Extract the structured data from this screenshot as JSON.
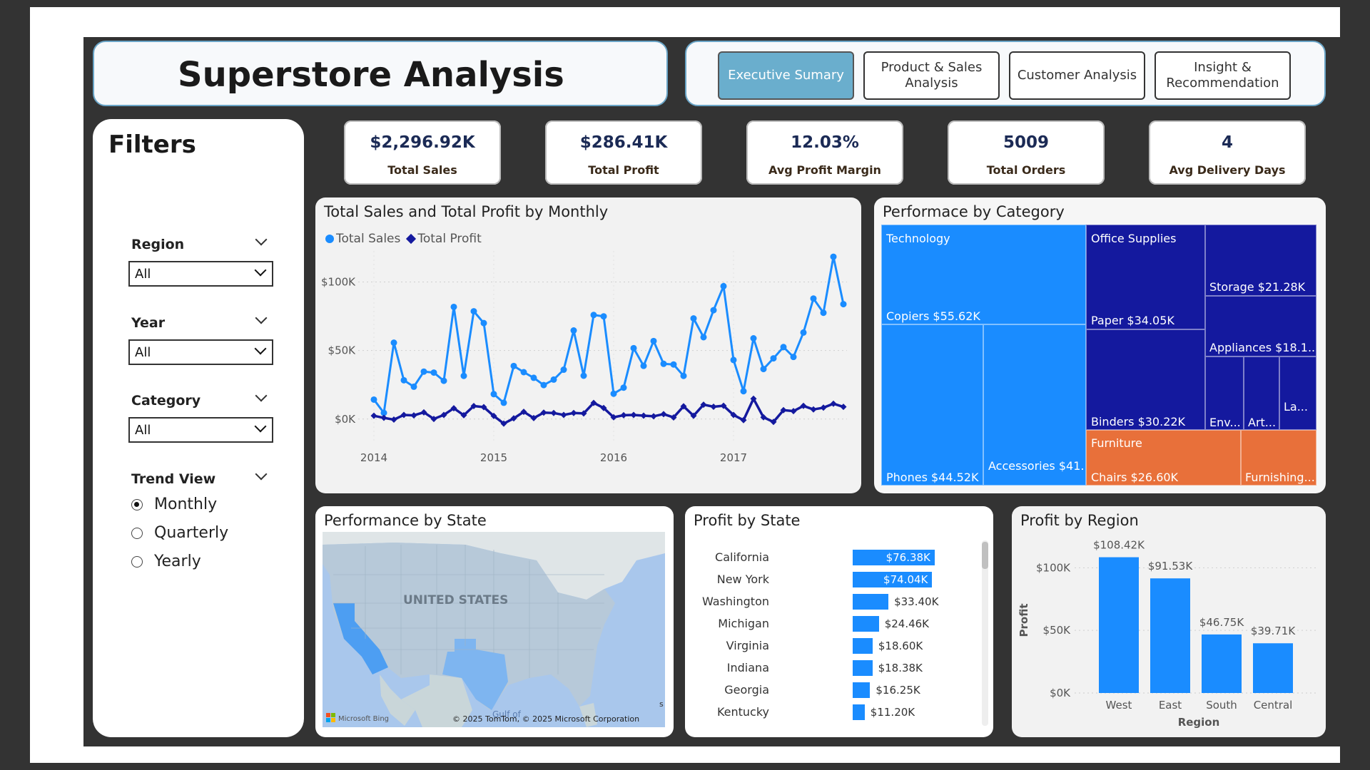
{
  "header": {
    "title": "Superstore Analysis",
    "tabs": [
      {
        "label": "Executive Sumary",
        "active": true
      },
      {
        "label": "Product & Sales\nAnalysis",
        "active": false
      },
      {
        "label": "Customer Analysis",
        "active": false
      },
      {
        "label": "Insight &\nRecommendation",
        "active": false
      }
    ]
  },
  "filters": {
    "title": "Filters",
    "region": {
      "label": "Region",
      "value": "All"
    },
    "year": {
      "label": "Year",
      "value": "All"
    },
    "category": {
      "label": "Category",
      "value": "All"
    },
    "trend": {
      "label": "Trend View",
      "options": [
        "Monthly",
        "Quarterly",
        "Yearly"
      ],
      "selected": "Monthly"
    }
  },
  "kpis": [
    {
      "value": "$2,296.92K",
      "label": "Total Sales"
    },
    {
      "value": "$286.41K",
      "label": "Total Profit"
    },
    {
      "value": "12.03%",
      "label": "Avg Profit Margin"
    },
    {
      "value": "5009",
      "label": "Total Orders"
    },
    {
      "value": "4",
      "label": "Avg Delivery Days"
    }
  ],
  "colors": {
    "sales": "#1a8cff",
    "profit": "#14199e",
    "furniture": "#e8703a",
    "accent": "#6aaecd"
  },
  "line_chart": {
    "title": "Total Sales and Total Profit by Monthly",
    "legend": [
      "Total Sales",
      "Total Profit"
    ],
    "chart_data": {
      "type": "line",
      "x_ticks": [
        "2014",
        "2015",
        "2016",
        "2017"
      ],
      "y_ticks": [
        "$0K",
        "$50K",
        "$100K"
      ],
      "ylim": [
        0,
        120000
      ],
      "series": [
        {
          "name": "Total Sales",
          "values": [
            14200,
            4500,
            55700,
            28300,
            23600,
            34600,
            33900,
            27900,
            81800,
            31500,
            78600,
            70000,
            18200,
            11900,
            38700,
            34200,
            30100,
            24800,
            28800,
            36000,
            64600,
            31600,
            75900,
            74900,
            18500,
            22900,
            51700,
            38800,
            56900,
            40300,
            39800,
            31500,
            73400,
            59700,
            79400,
            96900,
            43100,
            20300,
            58900,
            36500,
            44300,
            52500,
            45300,
            63100,
            87900,
            77500,
            118400,
            83800
          ]
        },
        {
          "name": "Total Profit",
          "values": [
            2400,
            900,
            -400,
            3000,
            2700,
            4900,
            100,
            3000,
            7900,
            2800,
            9500,
            8700,
            2300,
            -3300,
            500,
            5300,
            700,
            4700,
            4400,
            3000,
            4400,
            4100,
            11800,
            8100,
            1300,
            2800,
            3000,
            2500,
            2000,
            3600,
            1200,
            9300,
            2400,
            10500,
            9000,
            9700,
            3000,
            -800,
            14800,
            1300,
            -2100,
            6500,
            5800,
            9600,
            7000,
            8300,
            11200,
            8900
          ]
        }
      ]
    }
  },
  "treemap": {
    "title": "Performace by Category",
    "items": [
      {
        "group": "Technology",
        "label": "Copiers $55.62K",
        "color": "#1a8cff"
      },
      {
        "group": "",
        "label": "Phones $44.52K",
        "color": "#1a8cff"
      },
      {
        "group": "",
        "label": "Accessories $41...",
        "color": "#1a8cff"
      },
      {
        "group": "Office Supplies",
        "label": "Paper $34.05K",
        "color": "#14199e"
      },
      {
        "group": "",
        "label": "Binders $30.22K",
        "color": "#14199e"
      },
      {
        "group": "",
        "label": "Storage $21.28K",
        "color": "#14199e"
      },
      {
        "group": "",
        "label": "Appliances $18.1...",
        "color": "#14199e"
      },
      {
        "group": "",
        "label": "Env...",
        "color": "#14199e"
      },
      {
        "group": "",
        "label": "Art...",
        "color": "#14199e"
      },
      {
        "group": "",
        "label": "La...",
        "color": "#14199e"
      },
      {
        "group": "Furniture",
        "label": "Chairs $26.60K",
        "color": "#e8703a"
      },
      {
        "group": "",
        "label": "Furnishing...",
        "color": "#e8703a"
      }
    ]
  },
  "map": {
    "title": "Performance by State",
    "country_label": "UNITED STATES",
    "gulf_label": "Gulf of\nMexico",
    "bing_label": "Microsoft Bing",
    "copyright": "© 2025 TomTom, © 2025 Microsoft Corporation",
    "edge_label": "s"
  },
  "profit_state": {
    "title": "Profit by State",
    "chart_data": {
      "type": "bar",
      "orientation": "horizontal",
      "categories": [
        "California",
        "New York",
        "Washington",
        "Michigan",
        "Virginia",
        "Indiana",
        "Georgia",
        "Kentucky"
      ],
      "values": [
        76380,
        74040,
        33400,
        24460,
        18600,
        18380,
        16250,
        11200
      ],
      "labels": [
        "$76.38K",
        "$74.04K",
        "$33.40K",
        "$24.46K",
        "$18.60K",
        "$18.38K",
        "$16.25K",
        "$11.20K"
      ]
    }
  },
  "profit_region": {
    "title": "Profit by Region",
    "chart_data": {
      "type": "bar",
      "categories": [
        "West",
        "East",
        "South",
        "Central"
      ],
      "values": [
        108420,
        91530,
        46750,
        39710
      ],
      "labels": [
        "$108.42K",
        "$91.53K",
        "$46.75K",
        "$39.71K"
      ],
      "y_ticks": [
        "$0K",
        "$50K",
        "$100K"
      ],
      "ylim": [
        0,
        115000
      ],
      "xlabel": "Region",
      "ylabel": "Profit"
    }
  }
}
